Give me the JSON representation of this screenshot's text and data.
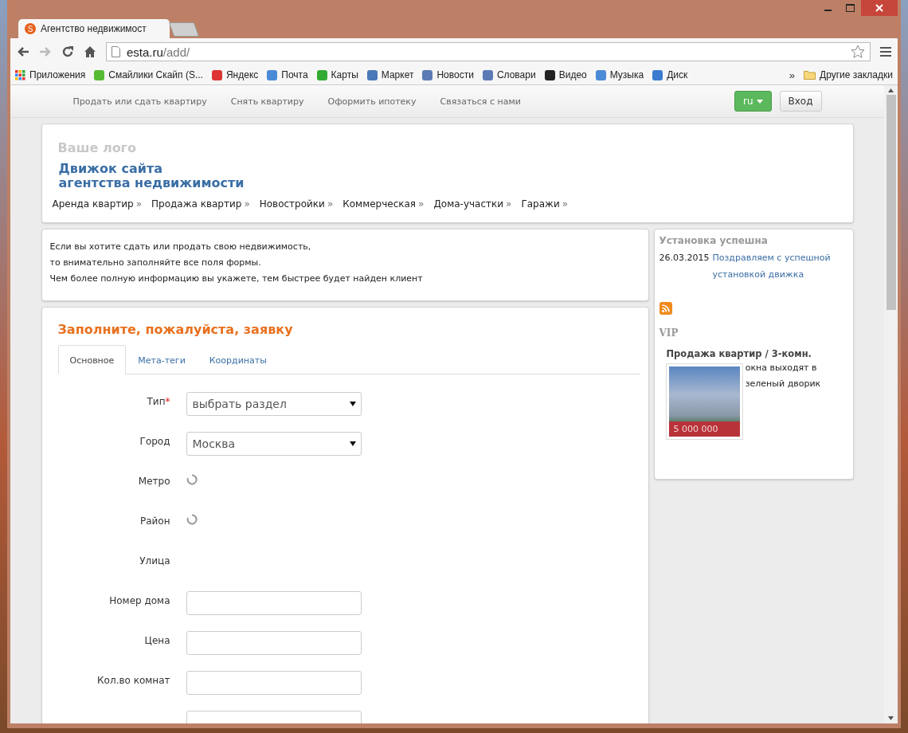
{
  "browser": {
    "tabs": [
      {
        "kind": "page",
        "favicon": "S",
        "title": "Агентство недвижимост",
        "selected": true
      },
      {
        "kind": "new",
        "selected": false
      }
    ],
    "address": {
      "host": "esta.ru",
      "path": "/add/"
    },
    "bookmarks": [
      "Приложения",
      "Смайлики Скайп (S...",
      "Яндекс",
      "Почта",
      "Карты",
      "Маркет",
      "Новости",
      "Словари",
      "Видео",
      "Музыка",
      "Диск"
    ],
    "overflow": "»",
    "other_bookmarks": "Другие закладки"
  },
  "topnav": {
    "links": [
      "Продать или сдать квартиру",
      "Снять квартиру",
      "Оформить ипотеку",
      "Связаться с нами"
    ],
    "lang_button": "ru",
    "login_button": "Вход"
  },
  "header": {
    "logo": "Ваше лого",
    "title_lines": [
      "Движок сайта",
      "агентства недвижимости"
    ],
    "menu": [
      {
        "label": "Аренда квартир",
        "arrow": "»"
      },
      {
        "label": "Продажа квартир",
        "arrow": "»"
      },
      {
        "label": "Новостройки",
        "arrow": "»"
      },
      {
        "label": "Коммерческая",
        "arrow": "»"
      },
      {
        "label": "Дома-участки",
        "arrow": "»"
      },
      {
        "label": "Гаражи",
        "arrow": "»"
      }
    ]
  },
  "info": [
    "Если вы хотите сдать или продать свою недвижимость,",
    "то внимательно заполняйте все поля формы.",
    "Чем более полную информацию вы укажете, тем быстрее будет найден клиент"
  ],
  "form": {
    "title": "Заполните, пожалуйста, заявку",
    "tabs": [
      {
        "label": "Основное",
        "selected": true
      },
      {
        "label": "Мета-теги",
        "selected": false
      },
      {
        "label": "Координаты",
        "selected": false
      }
    ],
    "rows": [
      {
        "kind": "select",
        "label": "Тип",
        "mark": "*",
        "value": "выбрать раздел"
      },
      {
        "kind": "select",
        "label": "Город",
        "value": "Москва"
      },
      {
        "kind": "loading",
        "label": "Метро"
      },
      {
        "kind": "loading",
        "label": "Район"
      },
      {
        "kind": "none",
        "label": "Улица"
      },
      {
        "kind": "input",
        "label": "Номер дома"
      },
      {
        "kind": "input",
        "label": "Цена"
      },
      {
        "kind": "input",
        "label": "Кол.во комнат"
      },
      {
        "kind": "input"
      }
    ]
  },
  "sidebar": {
    "news_title": "Установка успешна",
    "news_date": "26.03.2015",
    "news_link": "Поздравляем с успешной установкой движка",
    "vip_title": "VIP",
    "vip_item": {
      "title": "Продажа квартир / 3-комн.",
      "price": "5 000 000",
      "description": "окна выходят в зеленый дворик"
    }
  }
}
